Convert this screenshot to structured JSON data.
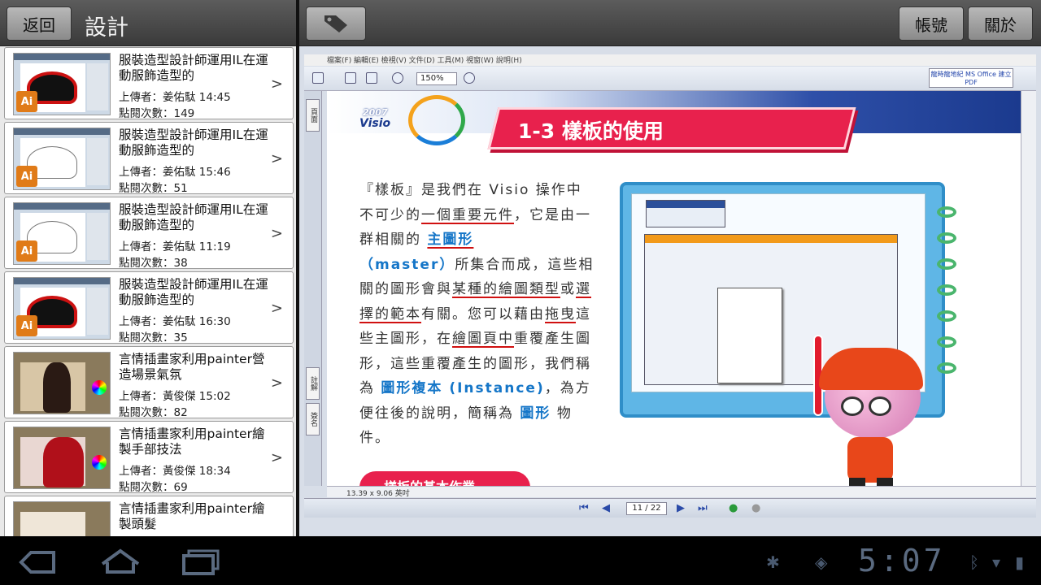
{
  "left_panel": {
    "back_label": "返回",
    "title": "設計",
    "items": [
      {
        "title": "服裝造型設計師運用IL在運動服飾造型的",
        "uploader": "上傳者：姜佑駄 14:45",
        "views": "點閱次數：149",
        "thumb_icon": "Ai"
      },
      {
        "title": "服裝造型設計師運用IL在運動服飾造型的",
        "uploader": "上傳者：姜佑駄 15:46",
        "views": "點閱次數：51",
        "thumb_icon": "Ai"
      },
      {
        "title": "服裝造型設計師運用IL在運動服飾造型的",
        "uploader": "上傳者：姜佑駄 11:19",
        "views": "點閱次數：38",
        "thumb_icon": "Ai"
      },
      {
        "title": "服裝造型設計師運用IL在運動服飾造型的",
        "uploader": "上傳者：姜佑駄 16:30",
        "views": "點閱次數：35",
        "thumb_icon": "Ai"
      },
      {
        "title": "言情插畫家利用painter營造場景氣氛",
        "uploader": "上傳者：黃俊傑 15:02",
        "views": "點閱次數：82",
        "thumb_icon": ""
      },
      {
        "title": "言情插畫家利用painter繪製手部技法",
        "uploader": "上傳者：黃俊傑 18:34",
        "views": "點閱次數：69",
        "thumb_icon": ""
      },
      {
        "title": "言情插畫家利用painter繪製頭髮",
        "uploader": "",
        "views": "",
        "thumb_icon": ""
      }
    ]
  },
  "right_header": {
    "account_label": "帳號",
    "about_label": "關於"
  },
  "viewer": {
    "menu": "檔案(F)  編輯(E)  檢視(V)  文件(D)  工具(M)  視窗(W)  說明(H)",
    "zoom": "150%",
    "logo_text": "龍時龍地紀 MS Office 建立 PDF",
    "page_indicator": "11 / 22",
    "page_size": "13.39 x 9.06 英吋",
    "sidetab_top": "頁面",
    "sidetab_mid": "註解",
    "sidetab_bot": "簽名"
  },
  "page": {
    "logo_year": "2007",
    "logo_name": "Visio",
    "heading": "1-3 樣板的使用",
    "para_1": "『樣板』是我們在 Visio 操作中不可少的",
    "para_2": "一個重要元件",
    "para_3": "，它是由一群相關的",
    "para_hl1": "主圖形",
    "para_hl2": "（master）",
    "para_4": "所集合而成，這些相關的圖形會與",
    "para_5": "某種的繪圖類型",
    "para_6": "或",
    "para_7": "選擇的範本",
    "para_8": "有關。您可以藉由",
    "para_9": "拖曳",
    "para_10": "這些主圖形，在",
    "para_11": "繪圖頁中",
    "para_12": "重覆產生圖形，這些重覆產生的圖形，我們稱為",
    "para_hl3": "圖形複本 (Instance)",
    "para_13": "，為方便往後的說明，簡稱為",
    "para_hl4": "圖形",
    "para_14": "物件。",
    "section_label": "樣板的基本作業"
  },
  "system_bar": {
    "clock": "5:07"
  }
}
